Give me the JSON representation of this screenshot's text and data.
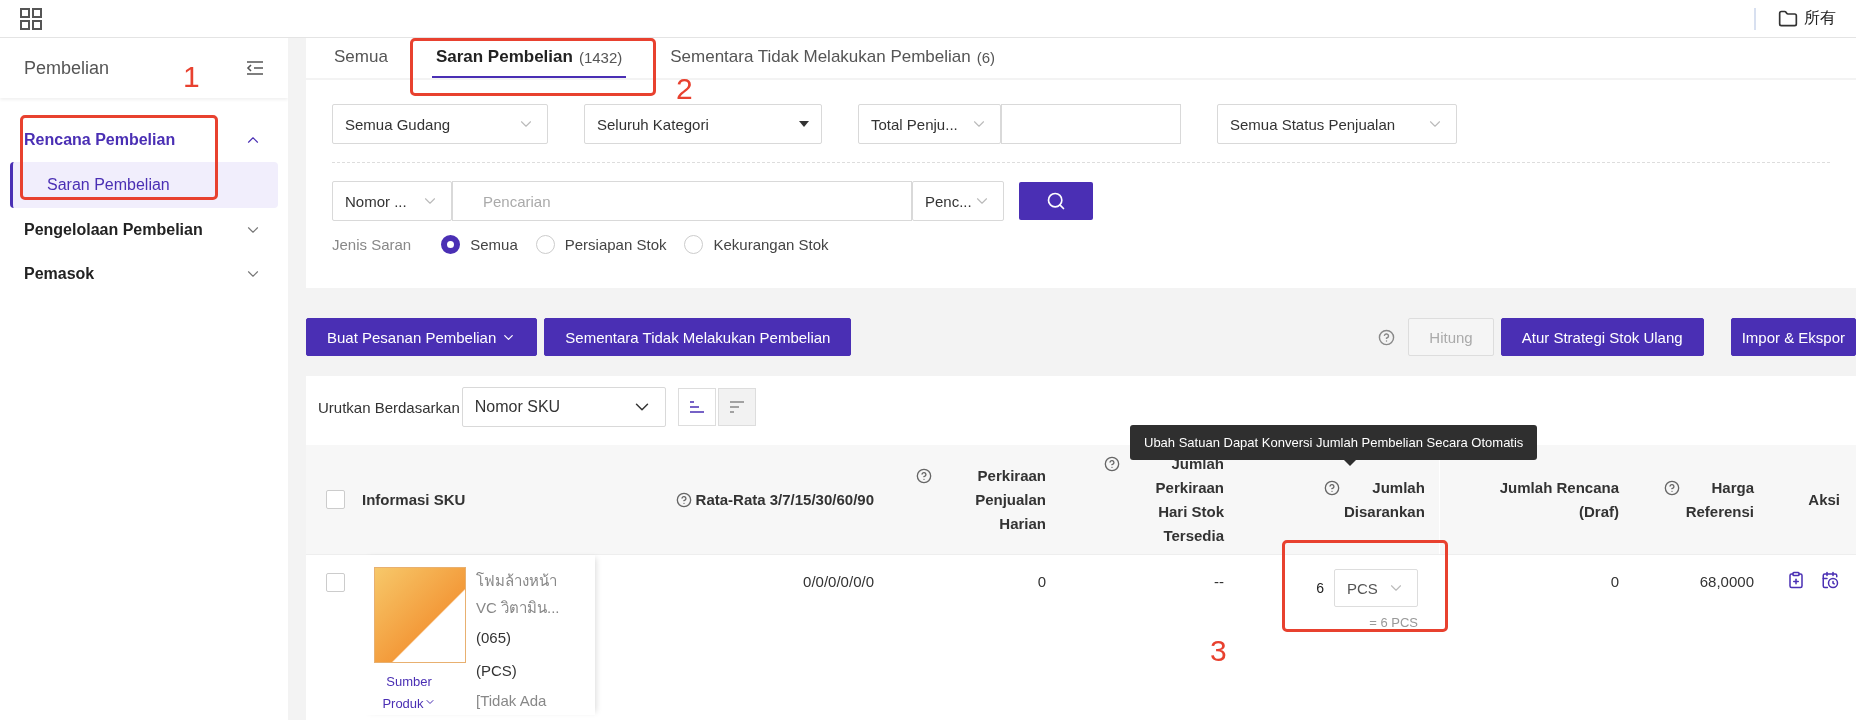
{
  "top_bar": {
    "workspace": "所有"
  },
  "sidebar": {
    "title": "Pembelian",
    "menu": [
      {
        "label": "Rencana Pembelian",
        "expanded": true,
        "active": true,
        "children": [
          {
            "label": "Saran Pembelian",
            "selected": true
          }
        ]
      },
      {
        "label": "Pengelolaan Pembelian",
        "expanded": false,
        "active": false
      },
      {
        "label": "Pemasok",
        "expanded": false,
        "active": false
      }
    ]
  },
  "tabs": [
    {
      "label": "Semua",
      "selected": false
    },
    {
      "label": "Saran Pembelian",
      "count": "(1432)",
      "selected": true
    },
    {
      "label": "Sementara Tidak Melakukan Pembelian",
      "count": "(6)",
      "selected": false
    }
  ],
  "filters": {
    "warehouse": "Semua Gudang",
    "category": "Seluruh Kategori",
    "sales_total": "Total Penju...",
    "sales_status": "Semua Status Penjualan",
    "search": {
      "field": "Nomor ...",
      "placeholder": "Pencarian",
      "mode": "Penc..."
    },
    "suggestion_type": {
      "label": "Jenis Saran",
      "options": [
        {
          "label": "Semua",
          "selected": true
        },
        {
          "label": "Persiapan Stok",
          "selected": false
        },
        {
          "label": "Kekurangan Stok",
          "selected": false
        }
      ]
    }
  },
  "actions_left": [
    {
      "label": "Buat Pesanan Pembelian",
      "kind": "dropdown"
    },
    {
      "label": "Sementara Tidak Melakukan Pembelian",
      "kind": "plain"
    }
  ],
  "actions_right": [
    {
      "label": "Hitung",
      "disabled": true
    },
    {
      "label": "Atur Strategi Stok Ulang",
      "disabled": false
    },
    {
      "label": "Impor & Ekspor",
      "disabled": false
    }
  ],
  "sort": {
    "label": "Urutkan Berdasarkan",
    "value": "Nomor SKU",
    "orders": [
      {
        "selected": true
      },
      {
        "selected": false
      }
    ]
  },
  "tooltip": "Ubah Satuan Dapat Konversi Jumlah Pembelian Secara Otomatis",
  "table": {
    "select_all": false,
    "columns": [
      {
        "label": "Informasi SKU",
        "help": false
      },
      {
        "label": "Rata-Rata 3/7/15/30/60/90",
        "help": true
      },
      {
        "label": "Perkiraan Penjualan Harian",
        "help": true
      },
      {
        "label": "Jumlah Perkiraan Hari Stok Tersedia",
        "help": true
      },
      {
        "label": "Jumlah Disarankan",
        "help": true
      },
      {
        "label": "Jumlah Rencana (Draf)",
        "help": false
      },
      {
        "label": "Harga Referensi",
        "help": true
      },
      {
        "label": "Aksi",
        "help": false
      }
    ],
    "rows": [
      {
        "checked": false,
        "name": "โฟมล้างหน้า VC วิตามิน...",
        "code": "(065)",
        "unit": "(PCS)",
        "note": "[Tidak Ada",
        "source": "Sumber Produk",
        "average": "0/0/0/0/0/0",
        "daily_sales": "0",
        "stock_days": "--",
        "suggested_qty": "6",
        "suggested_unit": "PCS",
        "converted": "= 6 PCS",
        "planned": "0",
        "price": "68,0000"
      }
    ]
  },
  "annotations": [
    {
      "label": "1"
    },
    {
      "label": "2"
    },
    {
      "label": "3"
    }
  ]
}
